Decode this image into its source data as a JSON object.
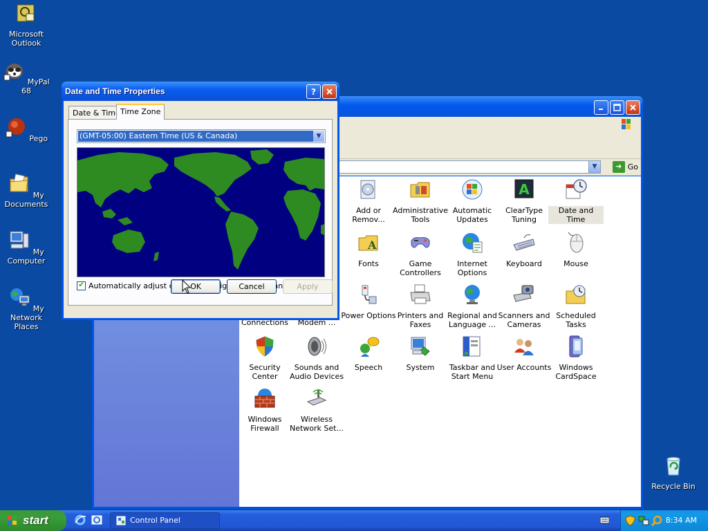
{
  "desktop": {
    "icons": [
      {
        "label": "Microsoft Outlook",
        "icon": "outlook-icon"
      },
      {
        "label": "MyPal 68",
        "icon": "mypal-icon"
      },
      {
        "label": "Pego",
        "icon": "pego-icon"
      },
      {
        "label": "My Documents",
        "icon": "my-documents-icon"
      },
      {
        "label": "My Computer",
        "icon": "my-computer-icon"
      },
      {
        "label": "My Network Places",
        "icon": "network-places-icon"
      },
      {
        "label": "Recycle Bin",
        "icon": "recycle-bin-icon"
      }
    ]
  },
  "control_panel": {
    "address_go": "Go",
    "items": [
      {
        "label": "Add or Remov...",
        "icon": "add-remove-programs-icon"
      },
      {
        "label": "Administrative Tools",
        "icon": "administrative-tools-icon"
      },
      {
        "label": "Automatic Updates",
        "icon": "automatic-updates-icon"
      },
      {
        "label": "ClearType Tuning",
        "icon": "cleartype-icon"
      },
      {
        "label": "Date and Time",
        "icon": "date-time-icon"
      },
      {
        "label": "Fonts",
        "icon": "fonts-icon"
      },
      {
        "label": "Game Controllers",
        "icon": "game-controllers-icon"
      },
      {
        "label": "Internet Options",
        "icon": "internet-options-icon"
      },
      {
        "label": "Keyboard",
        "icon": "keyboard-icon"
      },
      {
        "label": "Mouse",
        "icon": "mouse-icon"
      },
      {
        "label": "Connections",
        "icon": "network-connections-icon"
      },
      {
        "label": "Modem ...",
        "icon": "modem-icon"
      },
      {
        "label": "Power Options",
        "icon": "power-options-icon"
      },
      {
        "label": "Printers and Faxes",
        "icon": "printers-icon"
      },
      {
        "label": "Regional and Language ...",
        "icon": "regional-icon"
      },
      {
        "label": "Scanners and Cameras",
        "icon": "scanners-icon"
      },
      {
        "label": "Scheduled Tasks",
        "icon": "scheduled-tasks-icon"
      },
      {
        "label": "Security Center",
        "icon": "security-center-icon"
      },
      {
        "label": "Sounds and Audio Devices",
        "icon": "sounds-icon"
      },
      {
        "label": "Speech",
        "icon": "speech-icon"
      },
      {
        "label": "System",
        "icon": "system-icon"
      },
      {
        "label": "Taskbar and Start Menu",
        "icon": "taskbar-icon"
      },
      {
        "label": "User Accounts",
        "icon": "user-accounts-icon"
      },
      {
        "label": "Windows CardSpace",
        "icon": "cardspace-icon"
      },
      {
        "label": "Windows Firewall",
        "icon": "firewall-icon"
      },
      {
        "label": "Wireless Network Set...",
        "icon": "wireless-icon"
      }
    ]
  },
  "dialog": {
    "title": "Date and Time Properties",
    "tabs": [
      "Date & Time",
      "Time Zone"
    ],
    "active_tab": "Time Zone",
    "timezone_value": "(GMT-05:00) Eastern Time (US & Canada)",
    "checkbox_label": "Automatically adjust clock for daylight saving changes",
    "checkbox_checked": true,
    "ok_label": "OK",
    "cancel_label": "Cancel",
    "apply_label": "Apply"
  },
  "taskbar": {
    "start_label": "start",
    "task_label": "Control Panel",
    "clock": "8:34 AM"
  },
  "colors": {
    "desktop": "#0a4aa3",
    "map_ocean": "#000080",
    "map_land": "#2e8b22",
    "selection": "#316ac5"
  }
}
